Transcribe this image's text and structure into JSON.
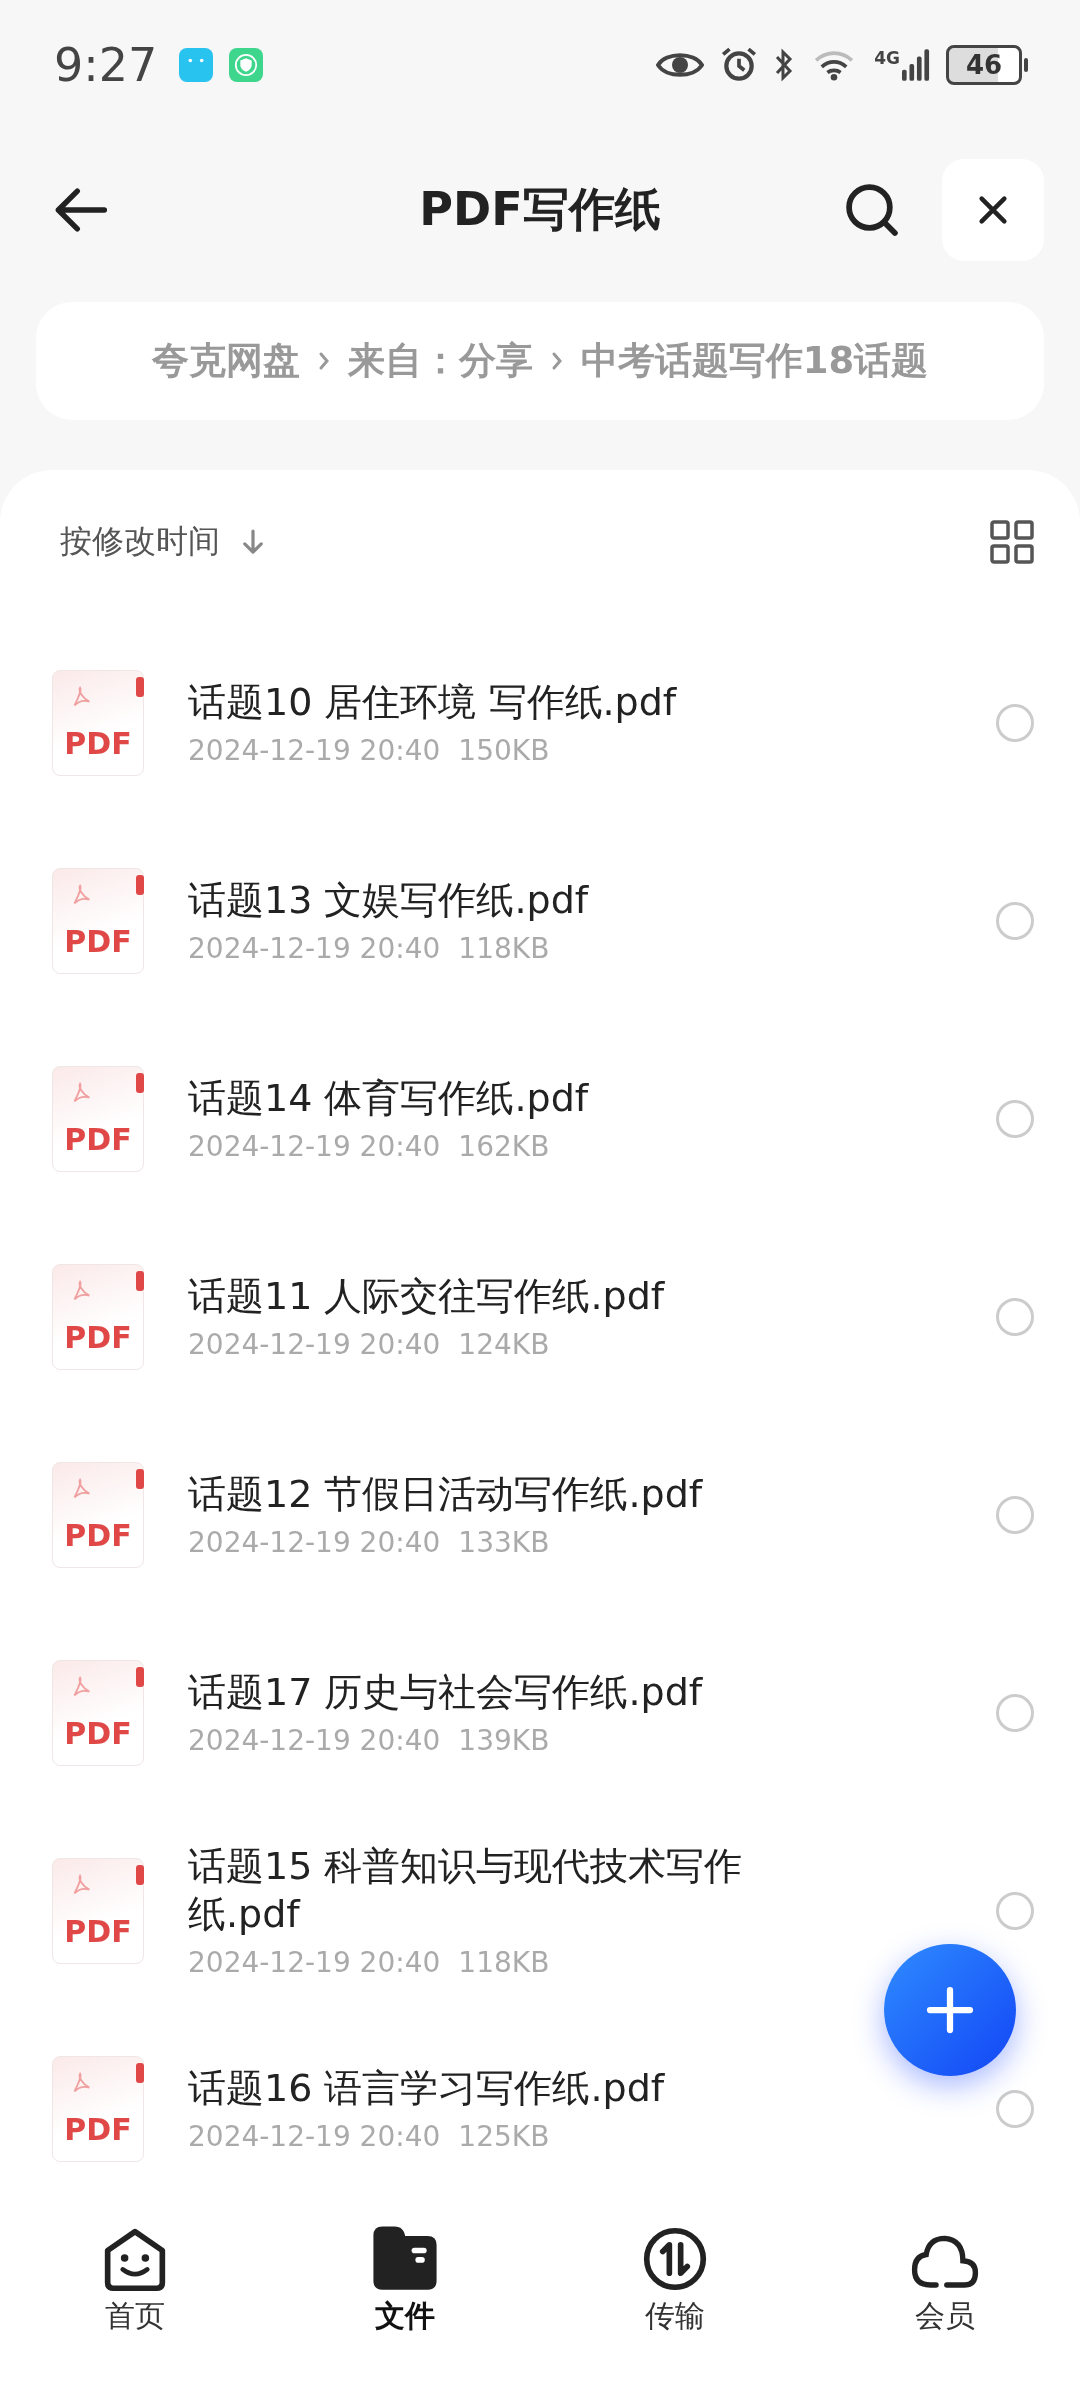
{
  "status_bar": {
    "time": "9:27",
    "network": "4G",
    "battery": "46"
  },
  "header": {
    "title": "PDF写作纸"
  },
  "breadcrumb": [
    "夸克网盘",
    "来自：分享",
    "中考话题写作18话题"
  ],
  "sort": {
    "label": "按修改时间"
  },
  "files": [
    {
      "icon_label": "PDF",
      "name": "话题10 居住环境 写作纸.pdf",
      "date": "2024-12-19 20:40",
      "size": "150KB",
      "selected": false
    },
    {
      "icon_label": "PDF",
      "name": "话题13 文娱写作纸.pdf",
      "date": "2024-12-19 20:40",
      "size": "118KB",
      "selected": false
    },
    {
      "icon_label": "PDF",
      "name": "话题14 体育写作纸.pdf",
      "date": "2024-12-19 20:40",
      "size": "162KB",
      "selected": false
    },
    {
      "icon_label": "PDF",
      "name": "话题11 人际交往写作纸.pdf",
      "date": "2024-12-19 20:40",
      "size": "124KB",
      "selected": false
    },
    {
      "icon_label": "PDF",
      "name": "话题12 节假日活动写作纸.pdf",
      "date": "2024-12-19 20:40",
      "size": "133KB",
      "selected": false
    },
    {
      "icon_label": "PDF",
      "name": "话题17 历史与社会写作纸.pdf",
      "date": "2024-12-19 20:40",
      "size": "139KB",
      "selected": false
    },
    {
      "icon_label": "PDF",
      "name": "话题15 科普知识与现代技术写作纸.pdf",
      "date": "2024-12-19 20:40",
      "size": "118KB",
      "selected": false
    },
    {
      "icon_label": "PDF",
      "name": "话题16 语言学习写作纸.pdf",
      "date": "2024-12-19 20:40",
      "size": "125KB",
      "selected": false
    }
  ],
  "nav": [
    {
      "kind": "home",
      "label": "首页",
      "selected": false
    },
    {
      "kind": "files",
      "label": "文件",
      "selected": true
    },
    {
      "kind": "transfer",
      "label": "传输",
      "selected": false
    },
    {
      "kind": "cloud",
      "label": "会员",
      "selected": false
    }
  ]
}
